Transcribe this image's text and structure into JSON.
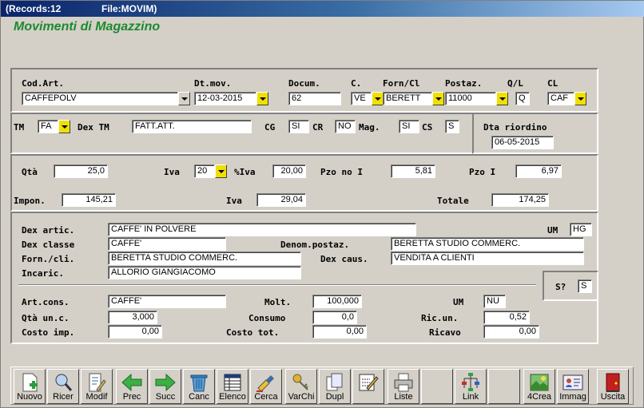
{
  "window": {
    "records": "(Records:12",
    "file": "File:MOVIM)"
  },
  "heading": "Movimenti di Magazzino",
  "labels": {
    "cod_art": "Cod.Art.",
    "dt_mov": "Dt.mov.",
    "docum": "Docum.",
    "c": "C.",
    "forn_cl": "Forn/Cl",
    "postaz": "Postaz.",
    "ql": "Q/L",
    "cl": "CL",
    "tm": "TM",
    "dex_tm": "Dex TM",
    "cg": "CG",
    "cr": "CR",
    "mag": "Mag.",
    "cs": "CS",
    "dta_riordino": "Dta riordino",
    "qta": "Qtà",
    "iva": "Iva",
    "pct_iva": "%Iva",
    "pzo_no_i": "Pzo no I",
    "pzo_i": "Pzo I",
    "impon": "Impon.",
    "iva2": "Iva",
    "totale": "Totale",
    "dex_artic": "Dex artic.",
    "um": "UM",
    "dex_classe": "Dex classe",
    "denom_postaz": "Denom.postaz.",
    "forn_cli": "Forn./cli.",
    "dex_caus": "Dex caus.",
    "incaric": "Incaric.",
    "s_q": "S?",
    "art_cons": "Art.cons.",
    "molt": "Molt.",
    "um2": "UM",
    "qta_unc": "Qtà un.c.",
    "consumo": "Consumo",
    "ric_un": "Ric.un.",
    "costo_imp": "Costo imp.",
    "costo_tot": "Costo tot.",
    "ricavo": "Ricavo"
  },
  "fields": {
    "cod_art": "CAFFEPOLV",
    "dt_mov": "12-03-2015",
    "docum": "62",
    "c": "VE",
    "forn_cl": "BERETT",
    "postaz": "11000",
    "ql": "Q",
    "cl": "CAF",
    "tm": "FA",
    "dex_tm": "FATT.ATT.",
    "cg": "SI",
    "cr": "NO",
    "mag": "SI",
    "cs": "S",
    "dta_riordino": "06-05-2015",
    "qta": "25,0",
    "iva": "20",
    "pct_iva": "20,00",
    "pzo_no_i": "5,81",
    "pzo_i": "6,97",
    "impon": "145,21",
    "iva2": "29,04",
    "totale": "174,25",
    "dex_artic": "CAFFE' IN POLVERE",
    "um": "HG",
    "dex_classe": "CAFFE'",
    "denom_postaz": "BERETTA STUDIO COMMERC.",
    "forn_cli": "BERETTA STUDIO COMMERC.",
    "dex_caus": "VENDITA A CLIENTI",
    "incaric": "ALLORIO GIANGIACOMO",
    "s_q": "S",
    "art_cons": "CAFFE'",
    "molt": "100,000",
    "um2": "NU",
    "qta_unc": "3,000",
    "consumo": "0,0",
    "ric_un": "0,52",
    "costo_imp": "0,00",
    "costo_tot": "0,00",
    "ricavo": "0,00"
  },
  "toolbar": [
    {
      "label": "Nuovo",
      "icon": "new-document-icon"
    },
    {
      "label": "Ricer",
      "icon": "magnifier-icon"
    },
    {
      "label": "Modif",
      "icon": "edit-document-icon"
    },
    {
      "label": "Prec",
      "icon": "arrow-left-icon"
    },
    {
      "label": "Succ",
      "icon": "arrow-right-icon"
    },
    {
      "label": "Canc",
      "icon": "trash-icon"
    },
    {
      "label": "Elenco",
      "icon": "table-list-icon"
    },
    {
      "label": "Cerca",
      "icon": "search-brush-icon"
    },
    {
      "label": "VarChi",
      "icon": "keys-icon"
    },
    {
      "label": "Dupl",
      "icon": "duplicate-icon"
    },
    {
      "label": "",
      "icon": "pencil-note-icon"
    },
    {
      "label": "Liste",
      "icon": "printer-icon"
    },
    {
      "label": "",
      "icon": "blank-icon"
    },
    {
      "label": "Link",
      "icon": "tree-link-icon"
    },
    {
      "label": "",
      "icon": "blank-icon"
    },
    {
      "label": "4Crea",
      "icon": "picture-create-icon"
    },
    {
      "label": "Immag",
      "icon": "id-card-icon"
    },
    {
      "label": "Uscita",
      "icon": "exit-door-icon"
    }
  ],
  "colors": {
    "heading": "#1c8a2e",
    "titlebar": "#0a246a",
    "dropdown_accent": "#f0e000"
  }
}
